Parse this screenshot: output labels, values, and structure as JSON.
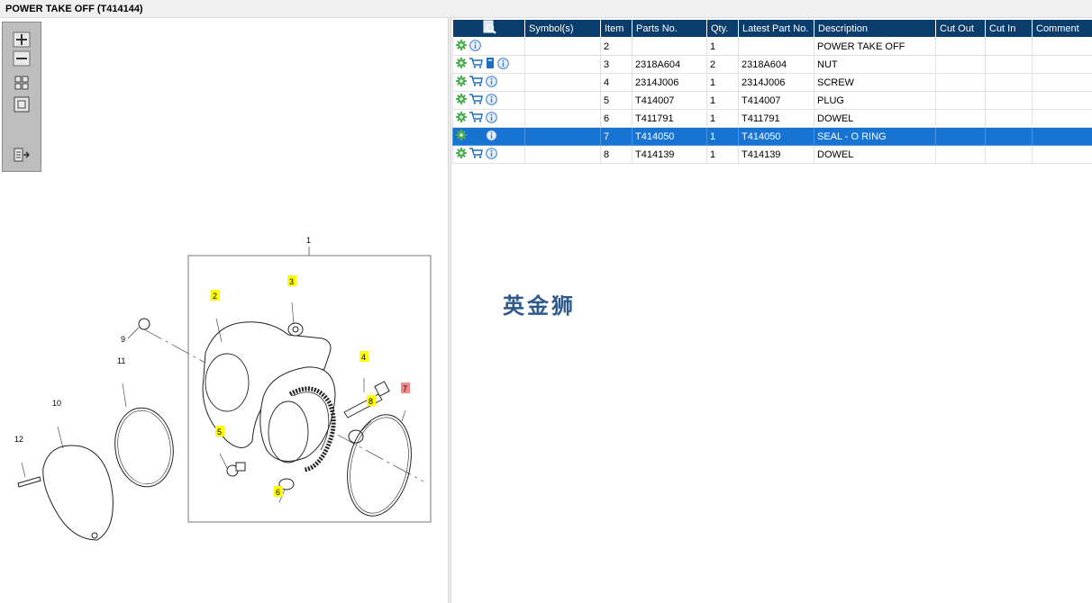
{
  "window": {
    "title": "POWER TAKE OFF (T414144)"
  },
  "toolbar": {
    "buttons": [
      "zoom-in",
      "zoom-out",
      "fit-all",
      "fit-window",
      "export"
    ]
  },
  "diagram": {
    "callouts": [
      "1",
      "2",
      "3",
      "4",
      "5",
      "6",
      "7",
      "8",
      "9",
      "10",
      "11",
      "12"
    ],
    "highlighted_callout": "7",
    "highlight_color": "#ffff00",
    "selected_color": "#f28a8a"
  },
  "table": {
    "headers": {
      "symbols": "Symbol(s)",
      "item": "Item",
      "parts_no": "Parts No.",
      "qty": "Qty.",
      "latest": "Latest Part No.",
      "description": "Description",
      "cut_out": "Cut Out",
      "cut_in": "Cut In",
      "comment": "Comment"
    },
    "rows": [
      {
        "item": "2",
        "parts_no": "",
        "qty": "1",
        "latest": "",
        "description": "POWER TAKE OFF",
        "cut_out": "",
        "cut_in": "",
        "comment": "",
        "icons": [
          "gear-icon",
          "info-icon"
        ]
      },
      {
        "item": "3",
        "parts_no": "2318A604",
        "qty": "2",
        "latest": "2318A604",
        "description": "NUT",
        "cut_out": "",
        "cut_in": "",
        "comment": "",
        "icons": [
          "gear-icon",
          "cart-icon",
          "book-icon",
          "info-icon"
        ]
      },
      {
        "item": "4",
        "parts_no": "2314J006",
        "qty": "1",
        "latest": "2314J006",
        "description": "SCREW",
        "cut_out": "",
        "cut_in": "",
        "comment": "",
        "icons": [
          "gear-icon",
          "cart-icon",
          "info-icon"
        ]
      },
      {
        "item": "5",
        "parts_no": "T414007",
        "qty": "1",
        "latest": "T414007",
        "description": "PLUG",
        "cut_out": "",
        "cut_in": "",
        "comment": "",
        "icons": [
          "gear-icon",
          "cart-icon",
          "info-icon"
        ]
      },
      {
        "item": "6",
        "parts_no": "T411791",
        "qty": "1",
        "latest": "T411791",
        "description": "DOWEL",
        "cut_out": "",
        "cut_in": "",
        "comment": "",
        "icons": [
          "gear-icon",
          "cart-icon",
          "info-icon"
        ]
      },
      {
        "item": "7",
        "parts_no": "T414050",
        "qty": "1",
        "latest": "T414050",
        "description": "SEAL - O RING",
        "cut_out": "",
        "cut_in": "",
        "comment": "",
        "icons": [
          "gear-icon",
          "cart-icon",
          "info-icon"
        ],
        "selected": true
      },
      {
        "item": "8",
        "parts_no": "T414139",
        "qty": "1",
        "latest": "T414139",
        "description": "DOWEL",
        "cut_out": "",
        "cut_in": "",
        "comment": "",
        "icons": [
          "gear-icon",
          "cart-icon",
          "info-icon"
        ]
      }
    ]
  },
  "watermark": {
    "text": "英金狮"
  },
  "colors": {
    "header_bg": "#0a3d6b",
    "selected_row": "#1874d2",
    "gear": "#4caf50",
    "cart": "#1e6fbf",
    "info": "#3a7bd5"
  }
}
